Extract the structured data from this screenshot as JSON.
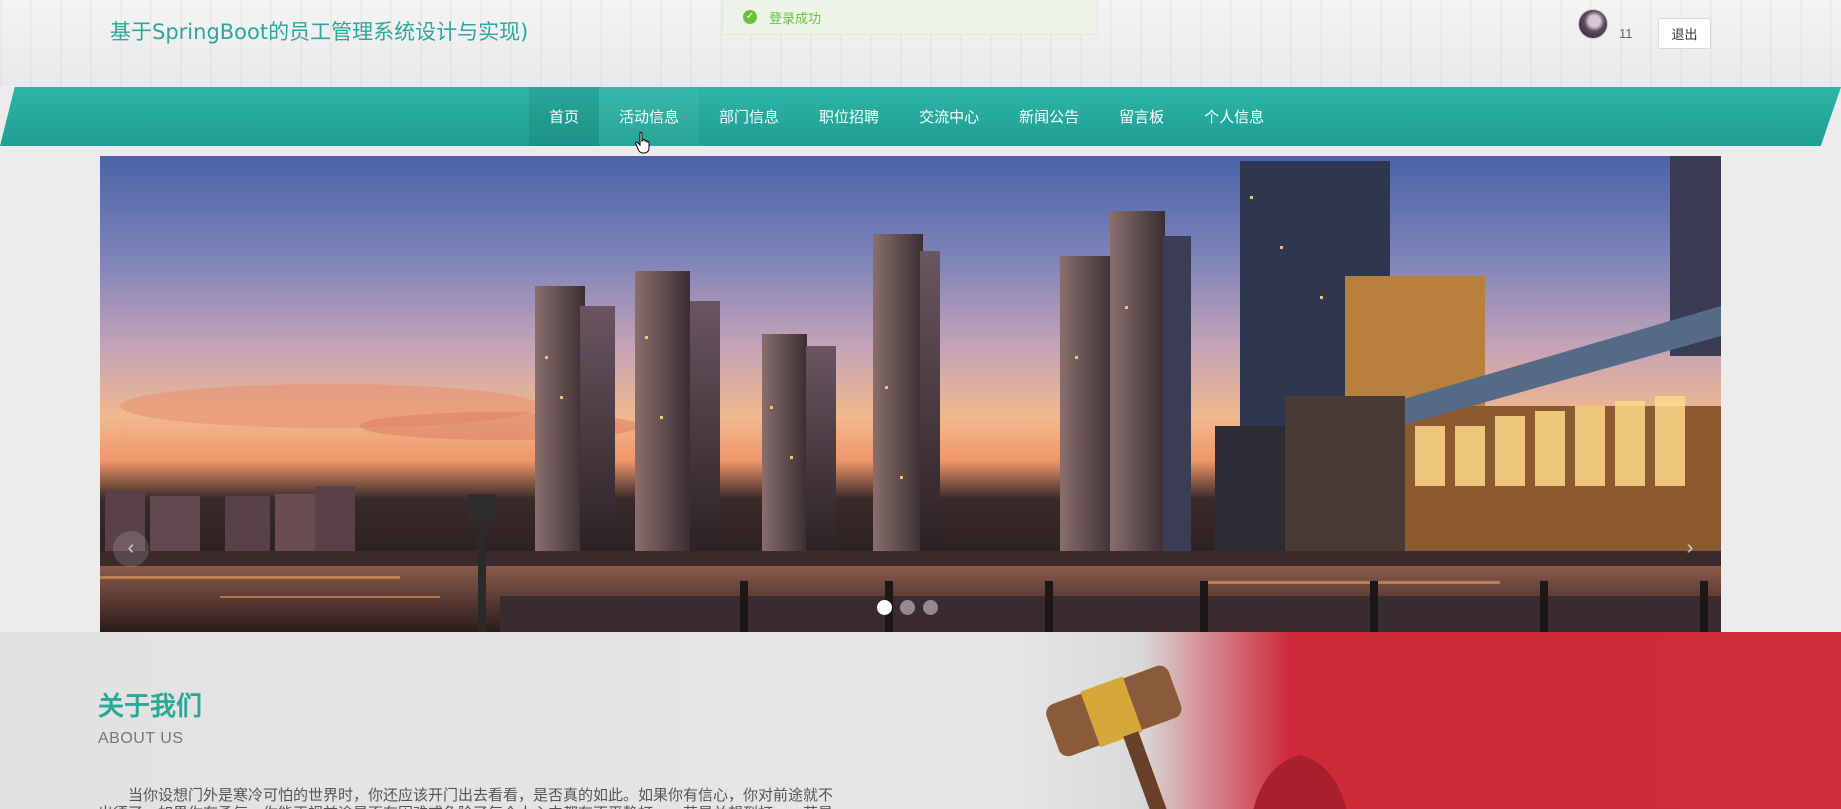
{
  "header": {
    "site_title": "基于SpringBoot的员工管理系统设计与实现)",
    "toast": {
      "icon": "check-icon",
      "text": "登录成功",
      "color": "#67c23a"
    },
    "user": {
      "name": "11",
      "logout_label": "退出"
    }
  },
  "nav": {
    "items": [
      {
        "label": "首页",
        "state": "active"
      },
      {
        "label": "活动信息",
        "state": "hover"
      },
      {
        "label": "部门信息"
      },
      {
        "label": "职位招聘"
      },
      {
        "label": "交流中心"
      },
      {
        "label": "新闻公告"
      },
      {
        "label": "留言板"
      },
      {
        "label": "个人信息"
      }
    ],
    "color": "#2cb5a6"
  },
  "carousel": {
    "prev_icon": "chevron-left-icon",
    "next_icon": "chevron-right-icon",
    "active_slide": 1,
    "slides_total": 3
  },
  "about": {
    "title": "关于我们",
    "subtitle": "ABOUT US",
    "text_line1": "当你设想门外是寒冷可怕的世界时，你还应该开门出去看看，是否真的如此。如果你有信心，你对前途就不",
    "text_line2": "出须了，如果你有勇气，你能正视前途是否有困难或危险了每个人心中都有不平静打，一若是关想到打，一若是"
  }
}
